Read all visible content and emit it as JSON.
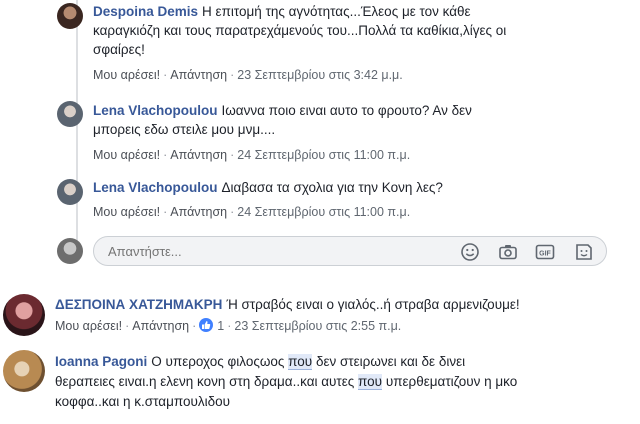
{
  "comments": [
    {
      "author": "Despoina Demis",
      "text_line1": "Η επιτομή της αγνότητας...Έλεος με τον κάθε",
      "text_line2": "καραγκιόζη και τους παρατρεχάμενούς του...Πολλά τα καθίκια,λίγες οι",
      "text_line3": "σφαίρες!",
      "like_label": "Μου αρέσει!",
      "reply_label": "Απάντηση",
      "time": "23 Σεπτεμβρίου στις 3:42 μ.μ."
    },
    {
      "author": "Lena Vlachopoulou",
      "text_line1": "Ιωαννα ποιο ειναι αυτο το φρουτο? Αν δεν",
      "text_line2": "μπορεις εδω στειλε μου μνμ....",
      "like_label": "Μου αρέσει!",
      "reply_label": "Απάντηση",
      "time": "24 Σεπτεμβρίου στις 11:00 π.μ."
    },
    {
      "author": "Lena Vlachopoulou",
      "text_line1": "Διαβασα τα σχολια για την Κονη λες?",
      "like_label": "Μου αρέσει!",
      "reply_label": "Απάντηση",
      "time": "24 Σεπτεμβρίου στις 11:00 π.μ."
    },
    {
      "author": "ΔΕΣΠΟΙΝΑ ΧΑΤΖΗΜΑΚΡΗ",
      "text_line1": "Ή στραβός ειναι ο γιαλός..ή στραβα αρμενιζουμε!",
      "like_label": "Μου αρέσει!",
      "reply_label": "Απάντηση",
      "like_count": "1",
      "time": "23 Σεπτεμβρίου στις 2:55 π.μ."
    },
    {
      "author": "Ioanna Pagoni",
      "text_a": "Ο υπεροχος φιλοςωος ",
      "text_hl1": "που",
      "text_b": " δεν στειρωνει και δε δινει",
      "text_c": "θεραπειες ειναι.η ελενη κονη στη δραμα..και αυτες ",
      "text_hl2": "που",
      "text_d": " υπερθεματιζουν η μκο",
      "text_e": "κοφφα..και η κ.σταμπουλιδου"
    }
  ],
  "reply_box": {
    "placeholder": "Απαντήστε..."
  },
  "reply_tools": [
    "emoji-icon",
    "camera-icon",
    "gif-icon",
    "sticker-icon"
  ],
  "colors": {
    "author": "#385898",
    "like_badge": "#4080ff",
    "highlight": "#e1e9f8"
  }
}
